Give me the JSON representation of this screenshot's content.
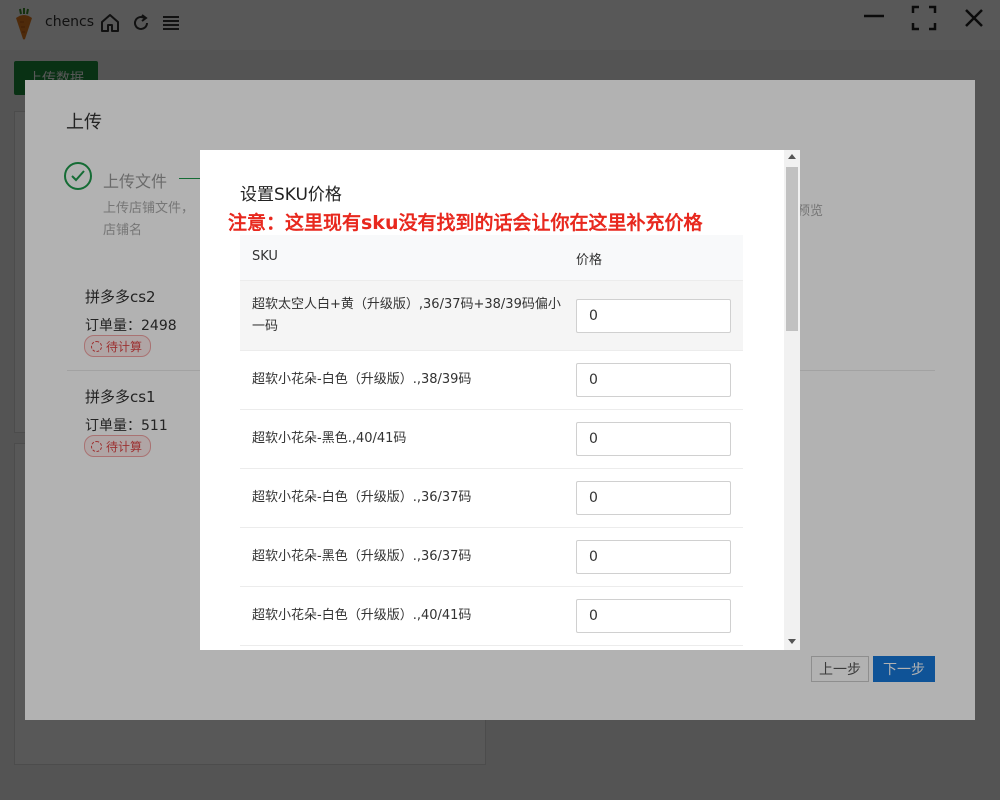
{
  "app": {
    "name": "chencs",
    "upload_data_button": "上传数据"
  },
  "upload_modal": {
    "title": "上传",
    "step": {
      "title": "上传文件",
      "description": "上传店铺文件，店铺名"
    },
    "preview_text": "预览",
    "shops": [
      {
        "name": "拼多多cs2",
        "orders": "订单量：2498",
        "status": "待计算"
      },
      {
        "name": "拼多多cs1",
        "orders": "订单量：511",
        "status": "待计算"
      }
    ],
    "prev_button": "上一步",
    "next_button": "下一步"
  },
  "sku_dialog": {
    "title": "设置SKU价格",
    "notice": "注意：这里现有sku没有找到的话会让你在这里补充价格",
    "columns": {
      "sku": "SKU",
      "price": "价格"
    },
    "rows": [
      {
        "sku": "超软太空人白+黄（升级版）,36/37码+38/39码偏小一码",
        "price": "0"
      },
      {
        "sku": "超软小花朵-白色（升级版）.,38/39码",
        "price": "0"
      },
      {
        "sku": "超软小花朵-黑色.,40/41码",
        "price": "0"
      },
      {
        "sku": "超软小花朵-白色（升级版）.,36/37码",
        "price": "0"
      },
      {
        "sku": "超软小花朵-黑色（升级版）.,36/37码",
        "price": "0"
      },
      {
        "sku": "超软小花朵-白色（升级版）.,40/41码",
        "price": "0"
      }
    ]
  },
  "colors": {
    "brand_green": "#1a8f3c",
    "primary_blue": "#1677d9",
    "notice_red": "#e8281e",
    "status_red": "#e04848"
  },
  "icons": [
    "carrot-logo-icon",
    "home-icon",
    "refresh-icon",
    "menu-icon",
    "minimize-icon",
    "fullscreen-icon",
    "close-icon",
    "check-icon",
    "loading-icon"
  ]
}
